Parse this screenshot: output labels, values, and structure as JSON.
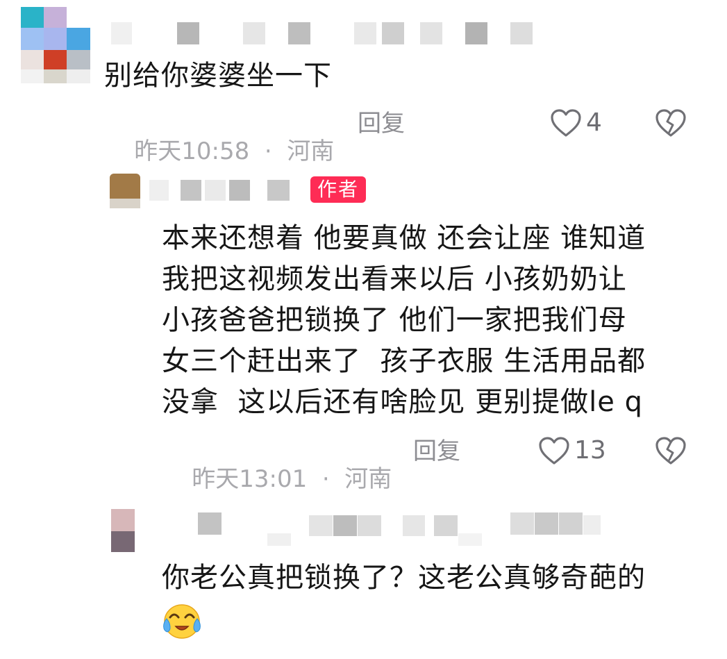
{
  "colors": {
    "text": "#161616",
    "meta": "#a9a9ad",
    "icon": "#707075",
    "author_badge": "#fe2c55"
  },
  "comments": [
    {
      "text": "别给你婆婆坐一下",
      "time": "昨天10:58",
      "location": "河南",
      "reply_label": "回复",
      "likes": "4",
      "icons": [
        "like-heart-icon",
        "dislike-broken-heart-icon"
      ]
    },
    {
      "author_badge": "作者",
      "lines": [
        "本来还想着 他要真做 还会让座 谁知道",
        "我把这视频发出看来以后 小孩奶奶让",
        "小孩爸爸把锁换了 他们一家把我们母",
        "女三个赶出来了  孩子衣服 生活用品都",
        "没拿  这以后还有啥脸见 更别提做le q"
      ],
      "time": "昨天13:01",
      "location": "河南",
      "reply_label": "回复",
      "likes": "13",
      "icons": [
        "like-heart-icon",
        "dislike-broken-heart-icon"
      ]
    },
    {
      "text": "你老公真把锁换了？这老公真够奇葩的",
      "emoji": "crying-laughing-emoji"
    }
  ]
}
